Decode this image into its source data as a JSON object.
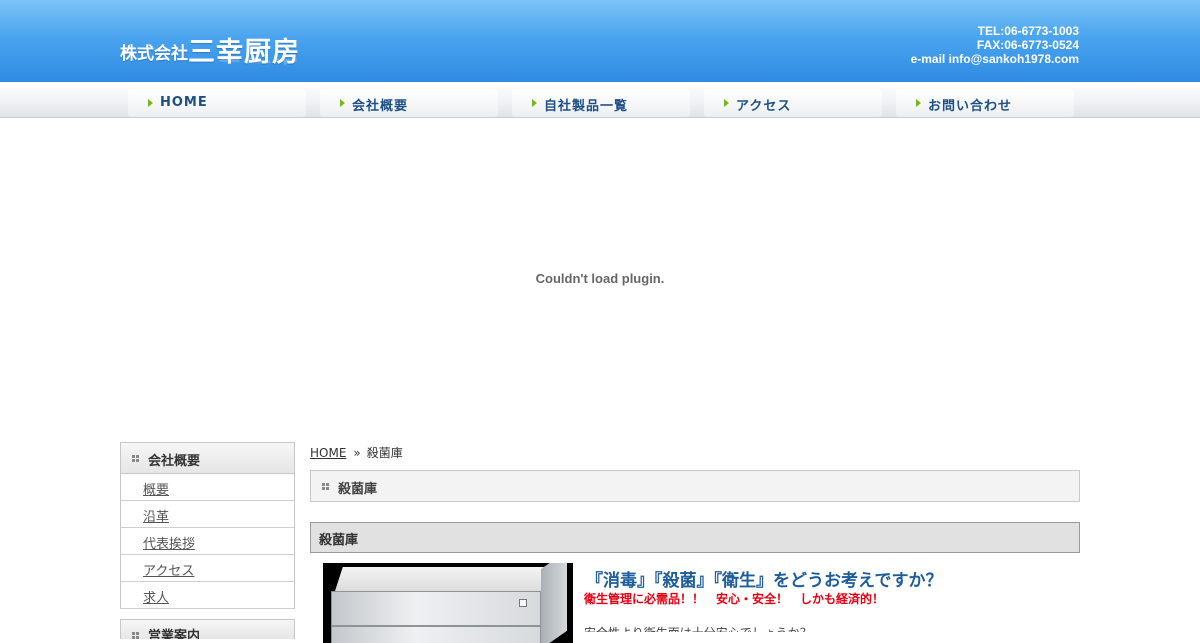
{
  "header": {
    "logo_small": "株式会社",
    "logo_big": "三幸厨房",
    "tel": "TEL:06-6773-1003",
    "fax": "FAX:06-6773-0524",
    "email": "e-mail info@sankoh1978.com"
  },
  "nav": [
    {
      "label": "HOME"
    },
    {
      "label": "会社概要"
    },
    {
      "label": "自社製品一覧"
    },
    {
      "label": "アクセス"
    },
    {
      "label": "お問い合わせ"
    }
  ],
  "plugin": {
    "message": "Couldn't load plugin."
  },
  "sidebar": {
    "heading": "会社概要",
    "items": [
      {
        "label": "概要"
      },
      {
        "label": "沿革"
      },
      {
        "label": "代表挨拶"
      },
      {
        "label": "アクセス"
      },
      {
        "label": "求人"
      }
    ],
    "heading2": "営業案内"
  },
  "breadcrumb": {
    "home": "HOME",
    "sep": "»",
    "current": "殺菌庫"
  },
  "main": {
    "title": "殺菌庫",
    "subtitle": "殺菌庫",
    "headline": "『消毒』『殺菌』『衛生』をどうお考えですか？",
    "red_text": "衛生管理に必需品！！　安心・安全！　しかも経済的！",
    "body_cut": "安全性より衛生面は十分安心でしょうか？"
  },
  "colors": {
    "header_blue": "#4aa4ee",
    "nav_text": "#1e4f86",
    "nav_arrow": "#7ab51d",
    "headline_blue": "#1d5d9b",
    "alert_red": "#e60012"
  }
}
